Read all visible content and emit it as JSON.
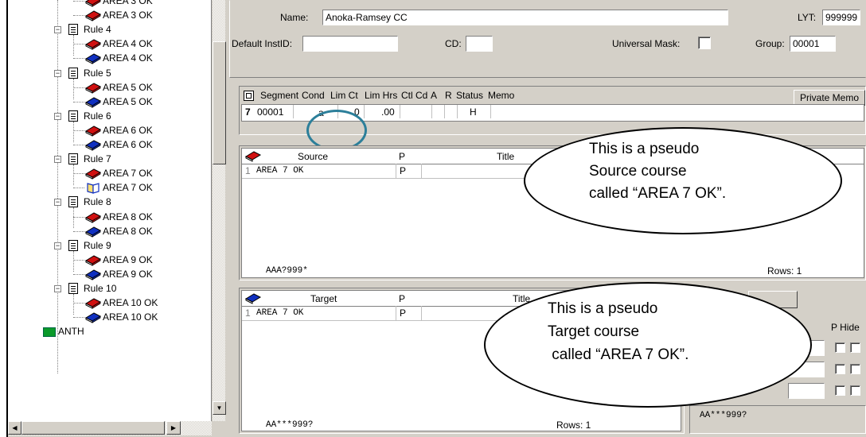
{
  "tree": {
    "items": [
      {
        "type": "book",
        "color": "red",
        "label": "AREA 3 OK",
        "partial": true
      },
      {
        "type": "book",
        "color": "red",
        "label": "AREA 3 OK"
      },
      {
        "type": "rule",
        "label": "Rule 4"
      },
      {
        "type": "book",
        "color": "red",
        "label": "AREA 4 OK"
      },
      {
        "type": "book",
        "color": "blue",
        "label": "AREA 4 OK"
      },
      {
        "type": "rule",
        "label": "Rule 5"
      },
      {
        "type": "book",
        "color": "red",
        "label": "AREA 5 OK"
      },
      {
        "type": "book",
        "color": "blue",
        "label": "AREA 5 OK"
      },
      {
        "type": "rule",
        "label": "Rule 6"
      },
      {
        "type": "book",
        "color": "red",
        "label": "AREA 6 OK"
      },
      {
        "type": "book",
        "color": "blue",
        "label": "AREA 6 OK"
      },
      {
        "type": "rule",
        "label": "Rule 7"
      },
      {
        "type": "book",
        "color": "red",
        "label": "AREA 7 OK"
      },
      {
        "type": "book",
        "color": "open",
        "label": "AREA 7 OK"
      },
      {
        "type": "rule",
        "label": "Rule 8"
      },
      {
        "type": "book",
        "color": "red",
        "label": "AREA 8 OK"
      },
      {
        "type": "book",
        "color": "blue",
        "label": "AREA 8 OK"
      },
      {
        "type": "rule",
        "label": "Rule 9"
      },
      {
        "type": "book",
        "color": "red",
        "label": "AREA 9 OK"
      },
      {
        "type": "book",
        "color": "blue",
        "label": "AREA 9 OK"
      },
      {
        "type": "rule",
        "label": "Rule 10"
      },
      {
        "type": "book",
        "color": "red",
        "label": "AREA 10 OK"
      },
      {
        "type": "book",
        "color": "blue",
        "label": "AREA 10 OK"
      },
      {
        "type": "folder",
        "label": "ANTH"
      }
    ]
  },
  "header": {
    "name_label": "Name:",
    "name_value": "Anoka-Ramsey CC",
    "lyt_label": "LYT:",
    "lyt_value": "999999",
    "instid_label": "Default InstID:",
    "instid_value": "",
    "cd_label": "CD:",
    "cd_value": "",
    "mask_label": "Universal Mask:",
    "group_label": "Group:",
    "group_value": "00001"
  },
  "segment": {
    "columns": [
      "Segment",
      "Cond",
      "Lim Ct",
      "Lim Hrs",
      "Ctl Cd",
      "A",
      "R",
      "Status",
      "Memo"
    ],
    "row": {
      "num": "7",
      "segment": "00001",
      "cond": "a",
      "lim_ct": "0",
      "lim_hrs": ".00",
      "ctl_cd": "",
      "a": "",
      "r": "",
      "status": "H",
      "memo": ""
    },
    "private_memo": "Private Memo"
  },
  "source": {
    "columns": [
      "Source",
      "P",
      "Title"
    ],
    "rows": [
      {
        "num": "1",
        "course": "AREA 7 OK",
        "p": "P"
      }
    ],
    "mask": "AAA?999*",
    "rows_count": "Rows: 1"
  },
  "target": {
    "columns": [
      "Target",
      "P",
      "Title"
    ],
    "rows": [
      {
        "num": "1",
        "course": "AREA 7 OK",
        "p": "P"
      }
    ],
    "mask": "AA***999?",
    "rows_count": "Rows: 1",
    "side_mask": "AA***999?",
    "p_hide": "P Hide"
  },
  "callouts": {
    "source_lines": [
      "This is a pseudo",
      "Source course",
      "called “AREA 7 OK”."
    ],
    "target_lines": [
      "This is a pseudo",
      "Target course",
      " called “AREA 7 OK”."
    ]
  },
  "colors": {
    "circle": "#2c7f9a",
    "book_red": "#d01010",
    "book_blue": "#1030c0"
  }
}
